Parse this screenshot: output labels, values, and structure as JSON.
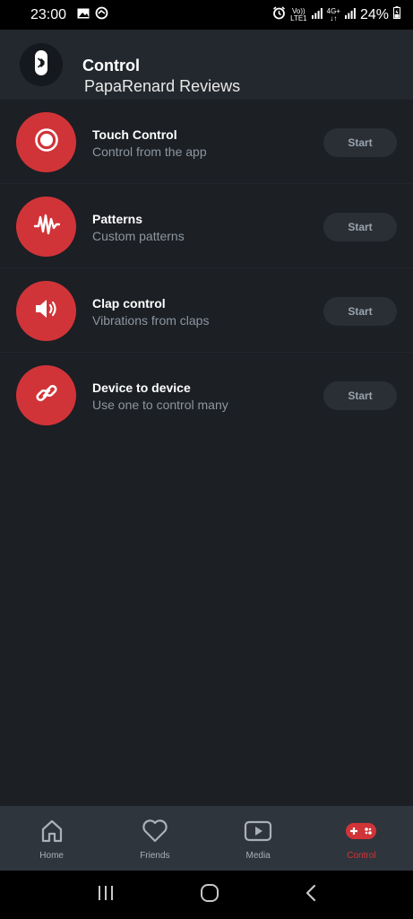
{
  "status_bar": {
    "time": "23:00",
    "battery": "24%",
    "volte_top": "Vo))",
    "volte_bottom": "LTE1",
    "net_top": "4G+",
    "net_bottom": "↓↑"
  },
  "header": {
    "title": "Control",
    "subtitle": "PapaRenard Reviews"
  },
  "items": [
    {
      "title": "Touch Control",
      "subtitle": "Control from the app",
      "button": "Start",
      "icon": "record-icon"
    },
    {
      "title": "Patterns",
      "subtitle": "Custom patterns",
      "button": "Start",
      "icon": "wave-icon"
    },
    {
      "title": "Clap control",
      "subtitle": "Vibrations from claps",
      "button": "Start",
      "icon": "speaker-icon"
    },
    {
      "title": "Device to device",
      "subtitle": "Use one to control many",
      "button": "Start",
      "icon": "link-icon"
    }
  ],
  "nav": [
    {
      "label": "Home",
      "icon": "home-icon"
    },
    {
      "label": "Friends",
      "icon": "heart-icon"
    },
    {
      "label": "Media",
      "icon": "play-icon"
    },
    {
      "label": "Control",
      "icon": "gamepad-icon",
      "active": true
    }
  ],
  "colors": {
    "accent": "#d13438",
    "background": "#1c1f24",
    "header": "#23282e",
    "nav": "#2f353d"
  }
}
